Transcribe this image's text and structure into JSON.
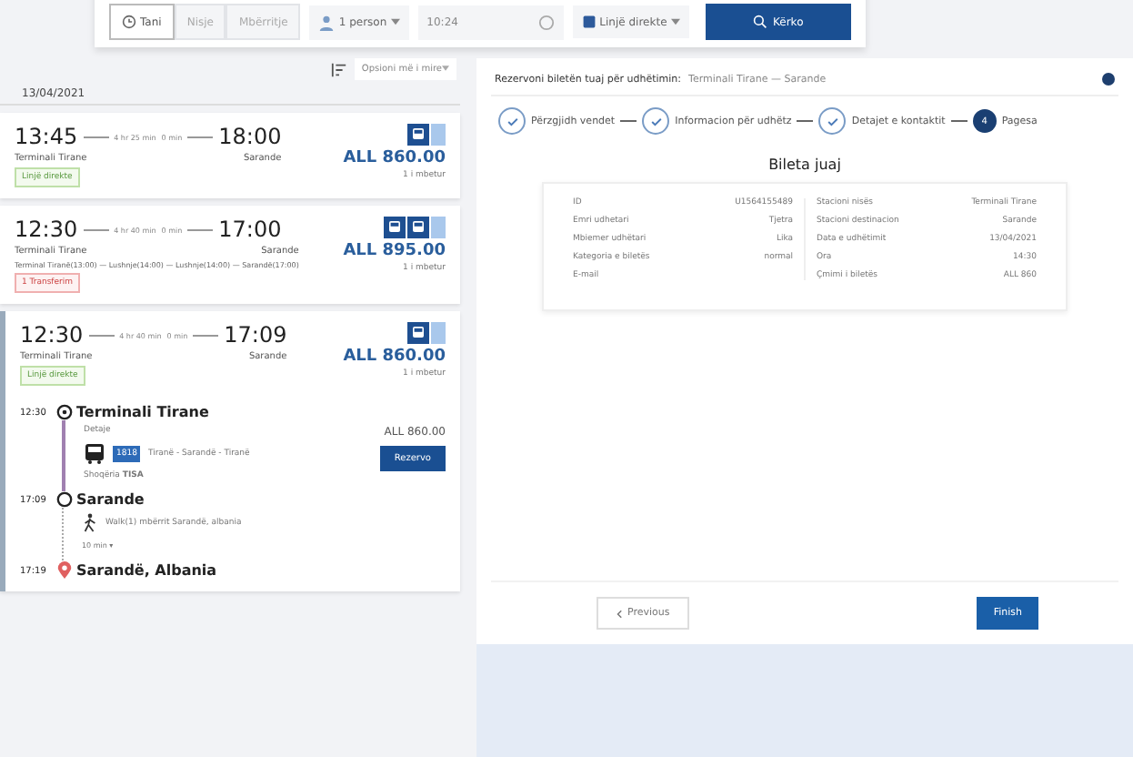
{
  "search_bar": {
    "time_modes": [
      {
        "label": "Tani",
        "selected": true
      },
      {
        "label": "Nisje",
        "selected": false
      },
      {
        "label": "Mbërritje",
        "selected": false
      }
    ],
    "passengers": "1 person",
    "time": "10:24",
    "line_filter": "Linjë direkte",
    "search_button": "Kërko"
  },
  "sort": {
    "label": "Opsioni më i mire"
  },
  "date": "13/04/2021",
  "results": [
    {
      "departure": "13:45",
      "arrival": "18:00",
      "duration": "4 hr 25 min",
      "wait": "0 min",
      "from": "Terminali Tirane",
      "to": "Sarande",
      "price": "ALL 860.00",
      "seats": "1 i mbetur",
      "tag": {
        "kind": "direct",
        "label": "Linjë direkte"
      },
      "expanded": false
    },
    {
      "departure": "12:30",
      "arrival": "17:00",
      "duration": "4 hr 40 min",
      "wait": "0 min",
      "from": "Terminali Tirane",
      "to": "Sarande",
      "price": "ALL 895.00",
      "seats": "1 i mbetur",
      "route": "Terminal Tiranë(13:00) — Lushnje(14:00) — Lushnje(14:00) — Sarandë(17:00)",
      "tag": {
        "kind": "transfer",
        "label": "1 Transferim"
      },
      "expanded": false
    },
    {
      "departure": "12:30",
      "arrival": "17:09",
      "duration": "4 hr 40 min",
      "wait": "0 min",
      "from": "Terminali Tirane",
      "to": "Sarande",
      "price": "ALL 860.00",
      "seats": "1 i mbetur",
      "tag": {
        "kind": "direct",
        "label": "Linjë direkte"
      },
      "expanded": true,
      "itinerary": {
        "origin": {
          "time": "12:30",
          "name": "Terminali Tirane"
        },
        "details": "Detaje",
        "line_number": "1818",
        "line_route": "Tiranë - Sarandë - Tiranë",
        "company_label": "Shoqëria",
        "company": "TISA",
        "price": "ALL 860.00",
        "book_button": "Rezervo",
        "stop": {
          "time": "17:09",
          "name": "Sarande"
        },
        "walk": "Walk(1) mbërrit Sarandë, albania",
        "walk_duration": "10 min ▾",
        "destination": {
          "time": "17:19",
          "name": "Sarandë, Albania"
        }
      }
    }
  ],
  "booking": {
    "heading": "Rezervoni biletën tuaj për udhëtimin:",
    "trip": "Terminali Tirane — Sarande",
    "steps": [
      {
        "label": "Përzgjidh vendet",
        "done": true
      },
      {
        "label": "Informacion për udhëtz",
        "done": true
      },
      {
        "label": "Detajet e kontaktit",
        "done": true
      },
      {
        "number": "4",
        "label": "Pagesa",
        "done": false
      }
    ],
    "ticket": {
      "title": "Bileta juaj",
      "left": [
        {
          "label": "ID",
          "value": "U1564155489"
        },
        {
          "label": "Emri udhetari",
          "value": "Tjetra"
        },
        {
          "label": "Mbiemer udhëtari",
          "value": "Lika"
        },
        {
          "label": "Kategoria e biletës",
          "value": "normal"
        },
        {
          "label": "E-mail"
        }
      ],
      "right": [
        {
          "label": "Stacioni nisës",
          "value": "Terminali Tirane"
        },
        {
          "label": "Stacioni destinacion",
          "value": "Sarande"
        },
        {
          "label": "Data e udhëtimit",
          "value": "13/04/2021"
        },
        {
          "label": "Ora",
          "value": "14:30"
        },
        {
          "label": "Çmimi i biletës",
          "value": "ALL 860"
        }
      ]
    },
    "previous_button": "Previous",
    "finish_button": "Finish"
  }
}
